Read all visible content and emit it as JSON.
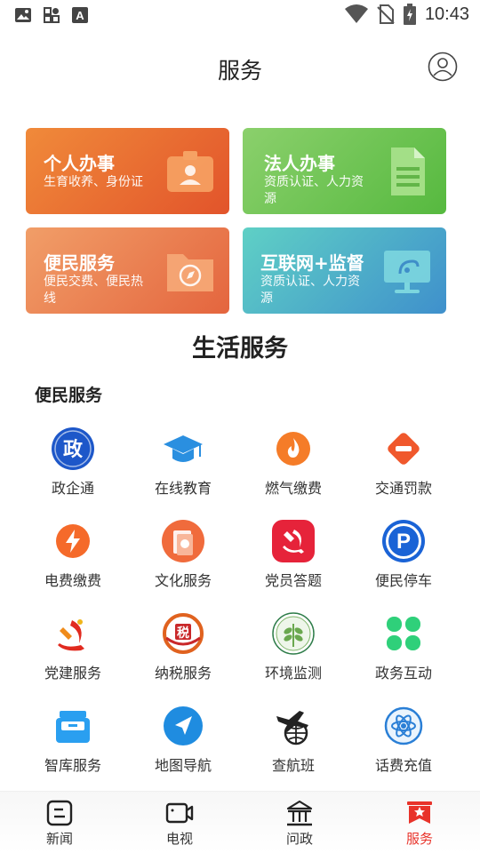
{
  "status_bar": {
    "time": "10:43"
  },
  "header": {
    "title": "服务"
  },
  "cards": [
    {
      "title": "个人办事",
      "subtitle": "生育收养、身份证"
    },
    {
      "title": "法人办事",
      "subtitle": "资质认证、人力资源"
    },
    {
      "title": "便民服务",
      "subtitle": "便民交费、便民热线"
    },
    {
      "title": "互联网+监督",
      "subtitle": "资质认证、人力资源"
    }
  ],
  "section": {
    "title": "生活服务",
    "subtitle": "便民服务"
  },
  "grid": [
    {
      "label": "政企通",
      "icon": "zheng-badge-icon",
      "glyph": "政"
    },
    {
      "label": "在线教育",
      "icon": "graduation-cap-icon"
    },
    {
      "label": "燃气缴费",
      "icon": "flame-icon"
    },
    {
      "label": "交通罚款",
      "icon": "no-entry-icon"
    },
    {
      "label": "电费缴费",
      "icon": "lightning-icon"
    },
    {
      "label": "文化服务",
      "icon": "book-icon"
    },
    {
      "label": "党员答题",
      "icon": "party-emblem-icon"
    },
    {
      "label": "便民停车",
      "icon": "parking-icon",
      "glyph": "P"
    },
    {
      "label": "党建服务",
      "icon": "party-building-icon"
    },
    {
      "label": "纳税服务",
      "icon": "tax-seal-icon",
      "glyph": "税"
    },
    {
      "label": "环境监测",
      "icon": "leaf-icon"
    },
    {
      "label": "政务互动",
      "icon": "clover-icon"
    },
    {
      "label": "智库服务",
      "icon": "storage-box-icon"
    },
    {
      "label": "地图导航",
      "icon": "navigation-arrow-icon"
    },
    {
      "label": "查航班",
      "icon": "airplane-globe-icon"
    },
    {
      "label": "话费充值",
      "icon": "atom-icon"
    }
  ],
  "bottom_nav": [
    {
      "label": "新闻",
      "icon": "news-icon",
      "active": false
    },
    {
      "label": "电视",
      "icon": "tv-camera-icon",
      "active": false
    },
    {
      "label": "问政",
      "icon": "government-building-icon",
      "active": false
    },
    {
      "label": "服务",
      "icon": "service-star-icon",
      "active": true
    }
  ],
  "colors": {
    "active": "#e8332a",
    "card1": "#e8602f",
    "card2": "#6cc24e",
    "card3": "#ea7a4f",
    "card4": "#4aa6c8"
  }
}
